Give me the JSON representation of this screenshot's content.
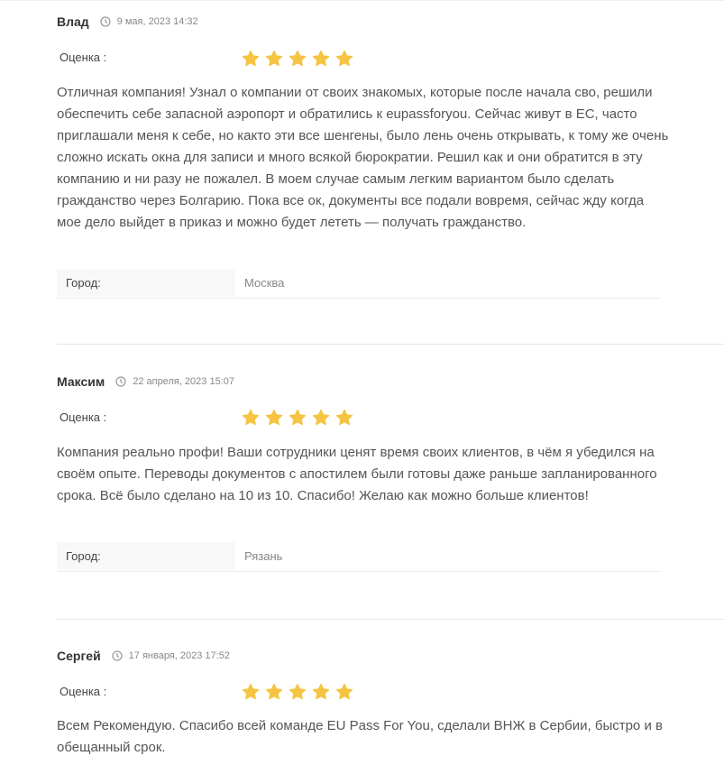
{
  "reviews": [
    {
      "author": "Влад",
      "date": "9 мая, 2023 14:32",
      "rating_label": "Оценка :",
      "rating": 5,
      "text": "Отличная компания! Узнал о компании от своих знакомых, которые после начала сво, решили обеспечить себе запасной аэропорт и обратились к eupassforyou. Сейчас живут в ЕС, часто приглашали меня к себе, но както эти все шенгены, было лень очень открывать, к тому же очень сложно искать окна для записи и много всякой бюрократии. Решил как и они обратится в эту компанию и ни разу не пожалел. В моем случае самым легким вариантом было сделать гражданство через Болгарию. Пока все ок, документы все подали вовремя, сейчас жду когда мое дело выйдет в приказ и можно будет лететь — получать гражданство.",
      "city_label": "Город:",
      "city": "Москва"
    },
    {
      "author": "Максим",
      "date": "22 апреля, 2023 15:07",
      "rating_label": "Оценка :",
      "rating": 5,
      "text": "Компания реально профи! Ваши сотрудники ценят время своих клиентов, в чём я убедился на своём опыте. Переводы документов с апостилем были готовы даже раньше запланированного срока. Всё было сделано на 10 из 10. Спасибо! Желаю как можно больше клиентов!",
      "city_label": "Город:",
      "city": "Рязань"
    },
    {
      "author": "Сергей",
      "date": "17 января, 2023 17:52",
      "rating_label": "Оценка :",
      "rating": 5,
      "text": "Всем Рекомендую. Спасибо всей команде EU Pass For You, сделали ВНЖ в Сербии, быстро и в обещанный срок."
    }
  ],
  "icons": {
    "date": "clock-icon",
    "rating": "star-icon"
  },
  "colors": {
    "star": "#f5c443",
    "divider": "#e6e6e6",
    "city_label_bg": "#f8f8f8"
  }
}
